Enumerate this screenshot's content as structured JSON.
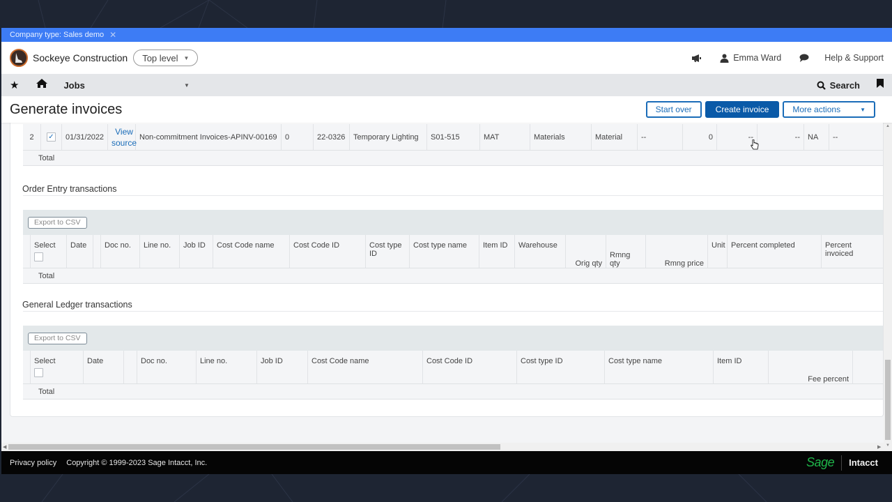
{
  "company_bar": {
    "label": "Company type: Sales demo",
    "close_icon": "close-icon"
  },
  "header": {
    "company_name": "Sockeye Construction",
    "level_selector": "Top level",
    "user_name": "Emma Ward",
    "help_label": "Help & Support",
    "icons": [
      "announcement-icon",
      "user-icon",
      "chat-icon"
    ]
  },
  "nav": {
    "module": "Jobs",
    "search_label": "Search",
    "icons": [
      "star-icon",
      "home-icon",
      "search-icon",
      "bookmark-icon"
    ]
  },
  "page": {
    "title": "Generate invoices",
    "buttons": {
      "start_over": "Start over",
      "create_invoice": "Create invoice",
      "more_actions": "More actions"
    }
  },
  "ap_table": {
    "row": {
      "row_no": "2",
      "selected": true,
      "date": "01/31/2022",
      "source_link": "View source",
      "doc": "Non-commitment Invoices-APINV-00169",
      "line": "0",
      "job_id": "22-0326",
      "cost_code_name": "Temporary Lighting",
      "cost_code_id": "S01-515",
      "cost_type_id": "MAT",
      "cost_type_name": "Materials",
      "item": "Material",
      "c1": "--",
      "c2": "0",
      "c3": "--",
      "c4": "--",
      "c5": "NA",
      "c6": "--"
    },
    "total_label": "Total"
  },
  "order_entry": {
    "title": "Order Entry transactions",
    "export_label": "Export to CSV",
    "columns": [
      "Select",
      "Date",
      "",
      "Doc no.",
      "Line no.",
      "Job ID",
      "Cost Code name",
      "Cost Code ID",
      "Cost type ID",
      "Cost type name",
      "Item ID",
      "Warehouse",
      "Orig qty",
      "Rmng qty",
      "Rmng price",
      "Unit",
      "Percent completed",
      "Percent invoiced"
    ],
    "total_label": "Total"
  },
  "general_ledger": {
    "title": "General Ledger transactions",
    "export_label": "Export to CSV",
    "columns": [
      "Select",
      "Date",
      "",
      "Doc no.",
      "Line no.",
      "Job ID",
      "Cost Code name",
      "Cost Code ID",
      "Cost type ID",
      "Cost type name",
      "Item ID",
      "Fee percent",
      ""
    ],
    "total_label": "Total"
  },
  "footer": {
    "privacy": "Privacy policy",
    "copyright": "Copyright © 1999-2023 Sage Intacct, Inc.",
    "brand_sage": "Sage",
    "brand_intacct": "Intacct"
  },
  "colors": {
    "accent": "#1a6cb8",
    "primary_button": "#0a5aa8",
    "company_bar": "#3d7cf5",
    "brand_green": "#1fb54a"
  }
}
